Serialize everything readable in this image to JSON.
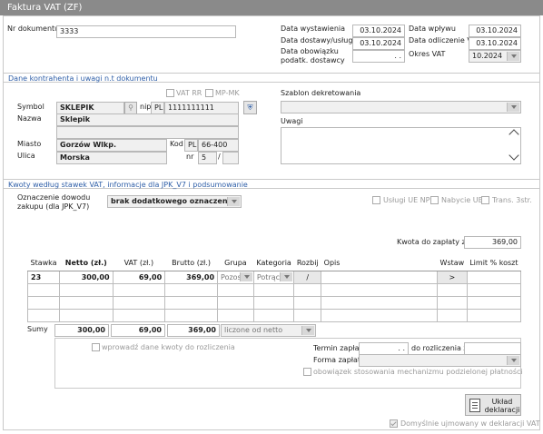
{
  "window": {
    "title": "Faktura VAT  (ZF)"
  },
  "doc": {
    "nr_label": "Nr dokumentu",
    "nr_value": "3333"
  },
  "dates": {
    "wystawienia_label": "Data wystawienia",
    "wystawienia": "03.10.2024",
    "dostawy_label": "Data dostawy/usługi",
    "dostawy": "03.10.2024",
    "obowiazku_label": "Data obowiązku podatk. dostawcy",
    "obowiazku": ". .",
    "wplywu_label": "Data wpływu",
    "wplywu": "03.10.2024",
    "odliczenie_label": "Data odliczenie VAT",
    "odliczenie": "03.10.2024",
    "okres_label": "Okres VAT",
    "okres": "10.2024"
  },
  "contractor": {
    "section_title": "Dane kontrahenta i uwagi n.t dokumentu",
    "vat_rr": "VAT RR",
    "mp_mk": "MP-MK",
    "symbol_label": "Symbol",
    "symbol": "SKLEPIK",
    "nip_label": "nip",
    "nip_prefix": "PL",
    "nip": "1111111111",
    "nazwa_label": "Nazwa",
    "nazwa": "Sklepik",
    "miasto_label": "Miasto",
    "miasto": "Gorzów Wlkp.",
    "kod_label": "Kod",
    "kod_prefix": "PL",
    "kod": "66-400",
    "ulica_label": "Ulica",
    "ulica": "Morska",
    "nr_label": "nr",
    "nr": "5",
    "nr_sep": "/",
    "szablon_label": "Szablon dekretowania",
    "uwagi_label": "Uwagi"
  },
  "vat": {
    "section_title": "Kwoty według stawek VAT, informacje dla JPK_V7 i podsumowanie",
    "oznaczenie_label": "Oznaczenie dowodu zakupu (dla JPK_V7)",
    "oznaczenie_value": "brak dodatkowego oznaczenia",
    "uslugi_ue": "Usługi UE NP",
    "nabycie_ue": "Nabycie UE",
    "trans": "Trans. 3str.",
    "kwota_label": "Kwota do zapłaty zł",
    "kwota": "369,00"
  },
  "table": {
    "headers": [
      "Stawka",
      "Netto (zł.)",
      "VAT (zł.)",
      "Brutto (zł.)",
      "Grupa",
      "Kategoria",
      "Rozbij",
      "Opis",
      "Wstaw",
      "Limit % koszt"
    ],
    "row": {
      "stawka": "23",
      "netto": "300,00",
      "vat": "69,00",
      "brutto": "369,00",
      "grupa": "Pozos",
      "kategoria": "Potrąc",
      "rozbij": "/",
      "wstaw": ">"
    },
    "sum_label": "Sumy",
    "sum_netto": "300,00",
    "sum_vat": "69,00",
    "sum_brutto": "369,00",
    "liczone": "liczone od netto"
  },
  "footer": {
    "wprowadz": "wprowadź dane kwoty do rozliczenia",
    "termin_label": "Termin zapłaty",
    "termin": ". .",
    "do_rozliczenia_label": "do rozliczenia zł",
    "forma_label": "Forma zapłaty",
    "mechanizm": "obowiązek stosowania mechanizmu podzielonej  płatności",
    "uklad_btn": "Układ deklaracji",
    "domyslnie": "Domyślnie ujmowany w deklaracji VAT"
  }
}
